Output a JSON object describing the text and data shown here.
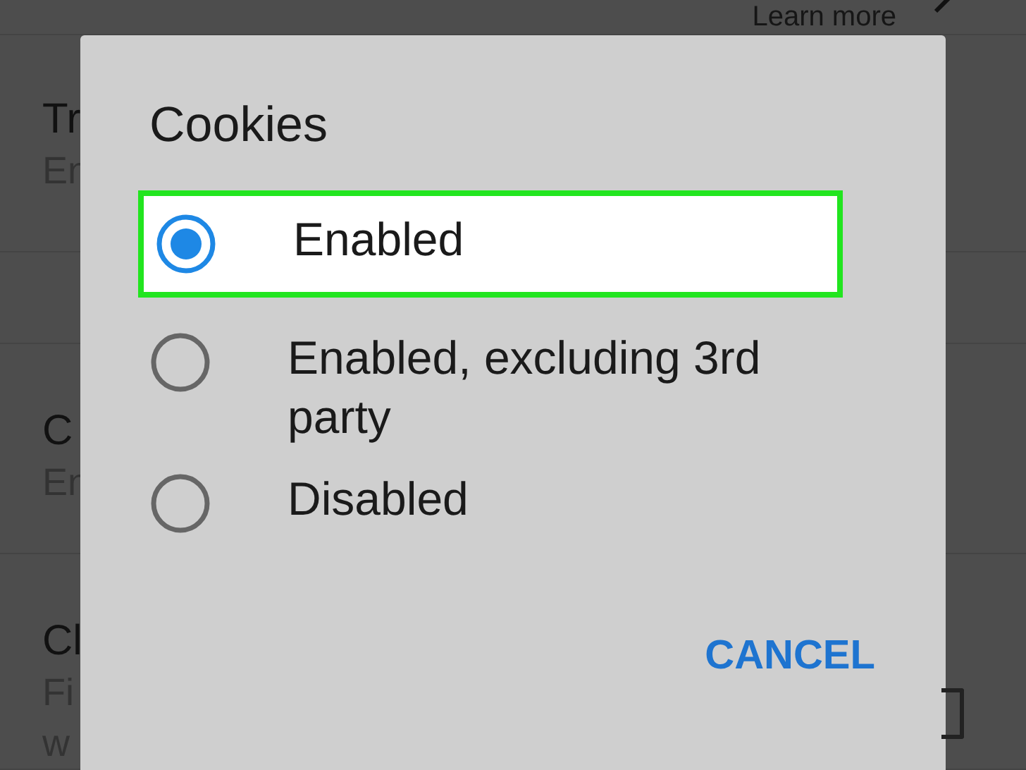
{
  "background": {
    "link": "Learn more",
    "items": [
      {
        "title": "Tr",
        "subtitle": "En"
      },
      {
        "title": "C",
        "subtitle": "En"
      },
      {
        "title": "Cl",
        "subtitle": "Fi",
        "subtitle_2": "w",
        "checked": false
      }
    ]
  },
  "dialog": {
    "title": "Cookies",
    "options": [
      {
        "label": "Enabled",
        "selected": true,
        "highlighted": true
      },
      {
        "label": "Enabled, excluding 3rd party",
        "selected": false,
        "highlighted": false
      },
      {
        "label": "Disabled",
        "selected": false,
        "highlighted": false
      }
    ],
    "buttons": [
      "CANCEL"
    ]
  }
}
